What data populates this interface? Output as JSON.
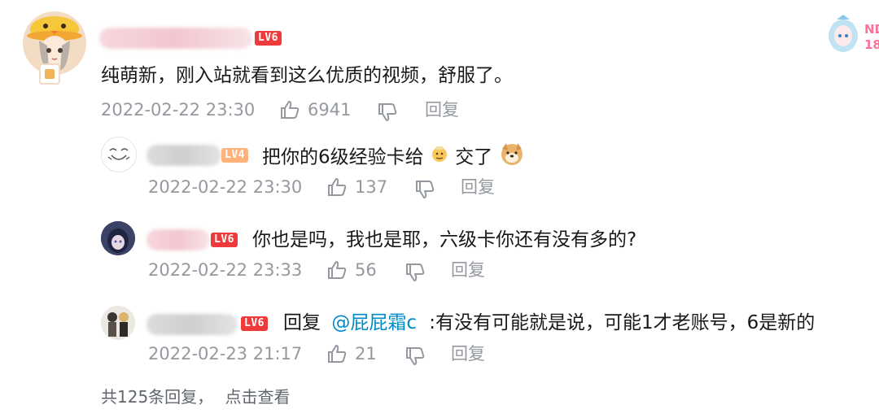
{
  "main_comment": {
    "level": "LV6",
    "text": "纯萌新，刚入站就看到这么优质的视频，舒服了。",
    "time": "2022-02-22 23:30",
    "likes": "6941",
    "reply_label": "回复"
  },
  "replies": [
    {
      "level": "LV4",
      "text_a": "把你的6级经验卡给",
      "text_b": "交了",
      "time": "2022-02-22 23:30",
      "likes": "137",
      "reply_label": "回复"
    },
    {
      "level": "LV6",
      "text": "你也是吗，我也是耶，六级卡你还有没有多的?",
      "time": "2022-02-22 23:33",
      "likes": "56",
      "reply_label": "回复"
    },
    {
      "level": "LV6",
      "prefix": "回复",
      "mention": "@屁屁霜c",
      "text": ":有没有可能就是说，可能1才老账号，6是新的",
      "time": "2022-02-23 21:17",
      "likes": "21",
      "reply_label": "回复"
    }
  ],
  "footer": {
    "count_text": "共125条回复，",
    "view_link": "点击查看"
  },
  "corner": {
    "line1": "ND",
    "line2": "18"
  },
  "colors": {
    "level6": "#ee3a3a",
    "level4": "#ffb37c",
    "meta": "#9499a0",
    "link": "#008ac5"
  }
}
